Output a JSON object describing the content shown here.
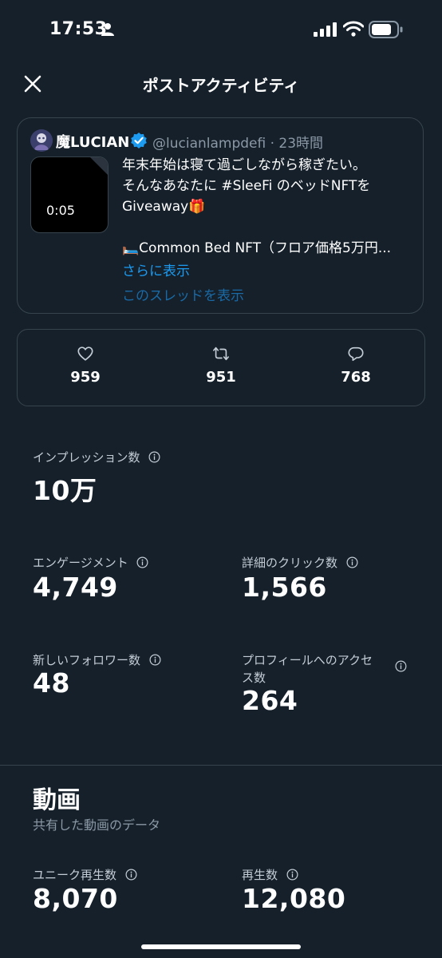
{
  "status_bar": {
    "time": "17:53"
  },
  "header": {
    "title": "ポストアクティビティ"
  },
  "post": {
    "author_name": "魔LUCIAN",
    "handle_time": "@lucianlampdefi · 23時間",
    "video_duration": "0:05",
    "text_line1": "年末年始は寝て過ごしながら稼ぎたい。",
    "text_line2": "そんなあなたに #SleeFi のベッドNFTを",
    "text_line3": "Giveaway🎁",
    "text_line4": "🛏️Common Bed NFT（フロア価格5万円...",
    "show_more": "さらに表示",
    "show_thread": "このスレッドを表示"
  },
  "engagement": {
    "likes": "959",
    "reposts": "951",
    "replies": "768"
  },
  "metrics": {
    "impressions_label": "インプレッション数",
    "impressions_value": "10万",
    "engagements_label": "エンゲージメント",
    "engagements_value": "4,749",
    "detail_clicks_label": "詳細のクリック数",
    "detail_clicks_value": "1,566",
    "new_followers_label": "新しいフォロワー数",
    "new_followers_value": "48",
    "profile_visits_label_line1": "プロフィールへのアクセ",
    "profile_visits_label_line2": "ス数",
    "profile_visits_value": "264"
  },
  "video_section": {
    "title": "動画",
    "subtitle": "共有した動画のデータ",
    "unique_views_label": "ユニーク再生数",
    "unique_views_value": "8,070",
    "views_label": "再生数",
    "views_value": "12,080"
  },
  "icons": {
    "close": "close-icon",
    "verified": "verified-badge-icon",
    "like": "heart-icon",
    "repost": "repost-icon",
    "reply": "reply-icon",
    "info": "info-icon"
  },
  "colors": {
    "background": "#15202b",
    "accent": "#1d9bf0",
    "border": "#38444d",
    "secondary_text": "#8b98a5"
  }
}
